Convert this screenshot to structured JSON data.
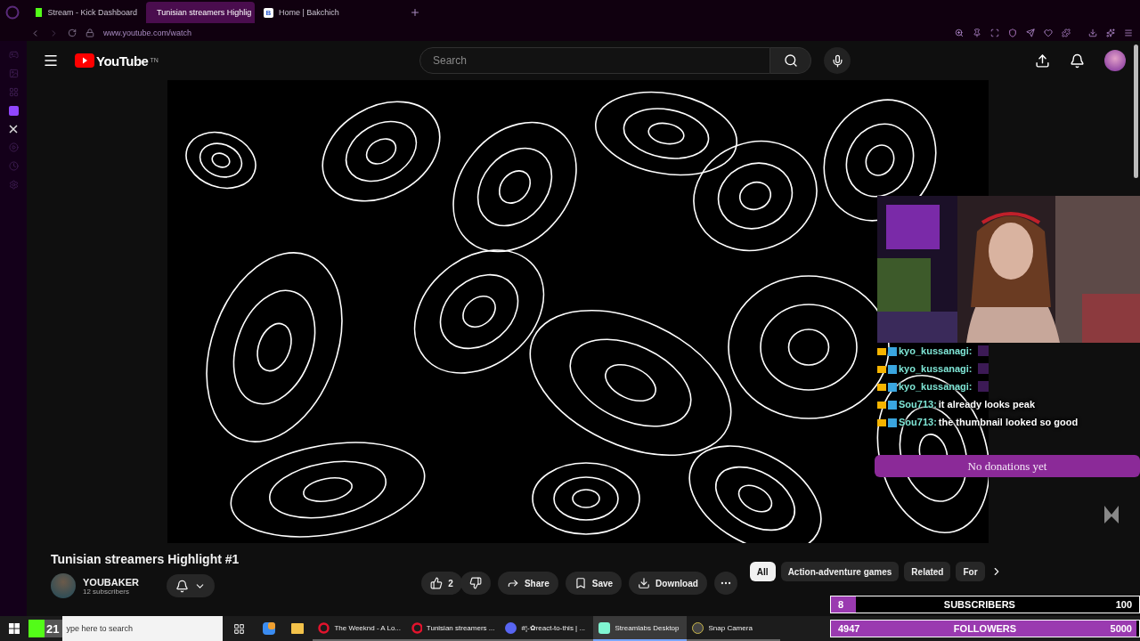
{
  "browser": {
    "tabs": [
      {
        "label": "Stream - Kick Dashboard",
        "selected": false,
        "kind": "kick"
      },
      {
        "label": "Tunisian streamers Highlig",
        "selected": true,
        "kind": "youtube"
      },
      {
        "label": "Home | Bakchich",
        "selected": false,
        "kind": "letter",
        "letter": "B"
      }
    ],
    "url_host": "www.youtube.com",
    "url_path": "/watch"
  },
  "youtube": {
    "logo": "YouTube",
    "region": "TN",
    "search": {
      "placeholder": "Search"
    }
  },
  "video": {
    "title": "Tunisian streamers Highlight #1",
    "channel": "YOUBAKER",
    "subscribers": "12 subscribers",
    "likes": "2",
    "actions": [
      "Share",
      "Save",
      "Download"
    ]
  },
  "chips": [
    {
      "label": "All",
      "selected": true
    },
    {
      "label": "Action-adventure games",
      "selected": false
    },
    {
      "label": "Related",
      "selected": false
    },
    {
      "label": "For",
      "selected": false
    }
  ],
  "overlay": {
    "chat": [
      {
        "user": "kyo_kussanagi:",
        "kind": "emote"
      },
      {
        "user": "kyo_kussanagi:",
        "kind": "emote"
      },
      {
        "user": "kyo_kussanagi:",
        "kind": "emote"
      },
      {
        "user": "Sou713:",
        "text": "it already looks peak",
        "kind": "text"
      },
      {
        "user": "Sou713:",
        "text": "the thumbnail looked so good",
        "kind": "text"
      }
    ],
    "donations": "No donations yet",
    "goals": [
      {
        "count": "8",
        "label": "SUBSCRIBERS",
        "target": "100",
        "level": 0.08
      },
      {
        "count": "4947",
        "label": "FOLLOWERS",
        "target": "5000",
        "level": 0.99
      }
    ],
    "kick_count": "21"
  },
  "taskbar": {
    "search": "ype here to search",
    "apps": [
      {
        "label": "The Weeknd - A Lo...",
        "selected": false,
        "kind": "opera"
      },
      {
        "label": "Tunisian streamers ...",
        "selected": false,
        "kind": "opera"
      },
      {
        "label": "#¦-✿react-to-this | ...",
        "selected": false,
        "kind": "discord"
      },
      {
        "label": "Streamlabs Desktop",
        "selected": true,
        "kind": "streamlabs"
      },
      {
        "label": "Snap Camera",
        "selected": false,
        "kind": "camera"
      }
    ]
  }
}
